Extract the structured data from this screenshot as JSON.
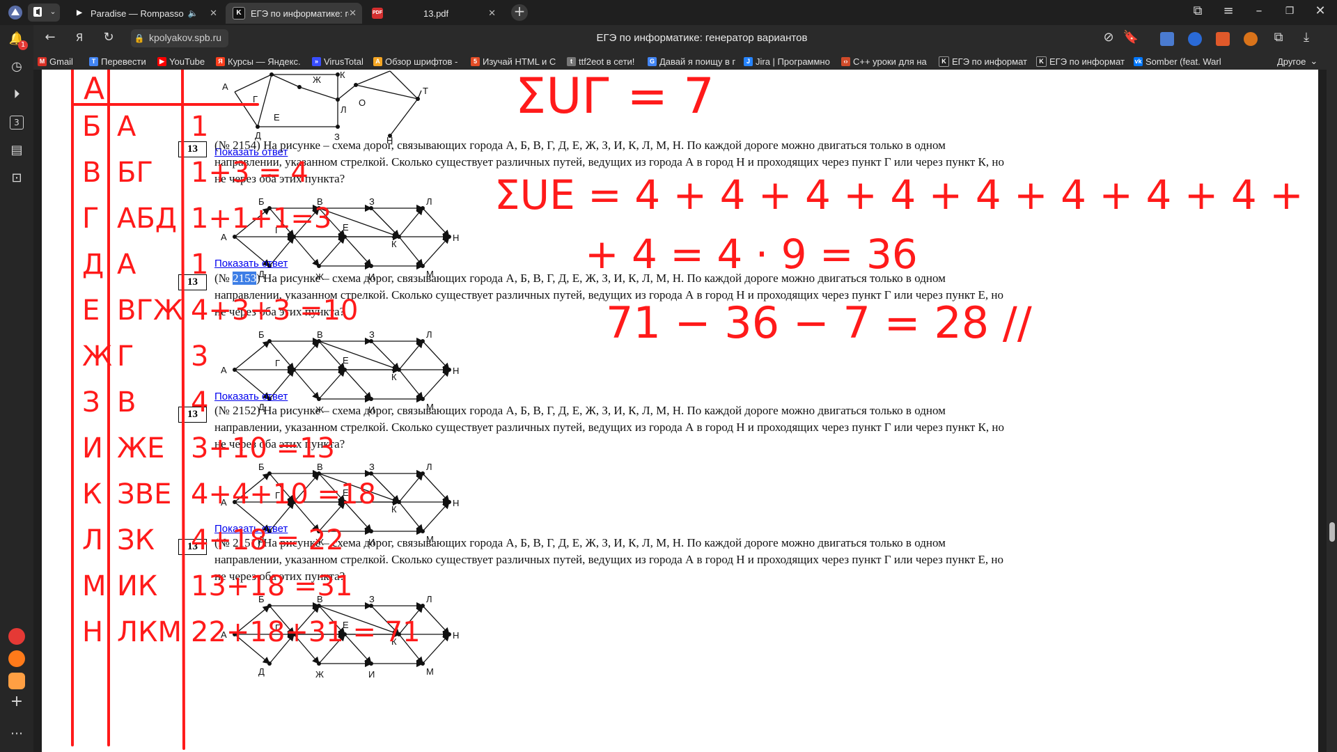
{
  "browser": {
    "tabs": [
      {
        "title": "Paradise — Rompasso",
        "favicon": "play-icon",
        "audio": true,
        "active": false
      },
      {
        "title": "ЕГЭ по информатике: ге",
        "favicon": "K-icon",
        "active": true
      },
      {
        "title": "13.pdf",
        "favicon": "pdf-icon",
        "active": false
      }
    ],
    "address": "kpolyakov.spb.ru",
    "page_title": "ЕГЭ по информатике: генератор вариантов",
    "notification_badge": "1",
    "sidebar_counter": "3",
    "bookmarks": [
      {
        "label": "Gmail",
        "icon": "gmail-icon",
        "color": "#d93025"
      },
      {
        "label": "Перевести",
        "icon": "translate-icon",
        "color": "#4285f4"
      },
      {
        "label": "YouTube",
        "icon": "youtube-icon",
        "color": "#ff0000"
      },
      {
        "label": "Курсы — Яндекс.",
        "icon": "yandex-icon",
        "color": "#fc3f1d"
      },
      {
        "label": "VirusTotal",
        "icon": "virustotal-icon",
        "color": "#394eff"
      },
      {
        "label": "Обзор шрифтов -",
        "icon": "fonts-icon",
        "color": "#f5a623"
      },
      {
        "label": "Изучай HTML и С",
        "icon": "html-icon",
        "color": "#e34c26"
      },
      {
        "label": "ttf2eot в сети!",
        "icon": "ttf-icon",
        "color": "#777777"
      },
      {
        "label": "Давай я поищу в г",
        "icon": "google-icon",
        "color": "#4285f4"
      },
      {
        "label": "Jira | Программно",
        "icon": "jira-icon",
        "color": "#2684ff"
      },
      {
        "label": "C++ уроки для на",
        "icon": "cpp-icon",
        "color": "#d04b2a"
      },
      {
        "label": "ЕГЭ по информат",
        "icon": "K-icon",
        "color": "#222222"
      },
      {
        "label": "ЕГЭ по информат",
        "icon": "K-icon",
        "color": "#222222"
      },
      {
        "label": "Somber (feat. Warl",
        "icon": "vk-icon",
        "color": "#0077ff"
      }
    ],
    "bookmarks_other": "Другое"
  },
  "tasks": [
    {
      "box": "13",
      "id_prefix": "(№ ",
      "id": "2154",
      "id_suffix": ") ",
      "text": "На рисунке – схема дорог, связывающих города А, Б, В, Г, Д, Е, Ж, З, И, К, Л, М, Н. По каждой дороге можно двигаться только в одном направлении, указанном стрелкой. Сколько существует различных путей, ведущих из города А в город Н и проходящих через пункт Г или через пункт К, но не через оба этих пункта?",
      "answer_link": "Показать ответ",
      "selected": false
    },
    {
      "box": "13",
      "id_prefix": "(№ ",
      "id": "2153",
      "id_suffix": ") ",
      "text": "На рисунке – схема дорог, связывающих города А, Б, В, Г, Д, Е, Ж, З, И, К, Л, М, Н. По каждой дороге можно двигаться только в одном направлении, указанном стрелкой. Сколько существует различных путей, ведущих из города А в город Н и проходящих через пункт Г или через пункт Е, но не через оба этих пункта?",
      "answer_link": "Показать ответ",
      "selected": true
    },
    {
      "box": "13",
      "id_prefix": "(№ ",
      "id": "2152",
      "id_suffix": ") ",
      "text": "На рисунке – схема дорог, связывающих города А, Б, В, Г, Д, Е, Ж, З, И, К, Л, М, Н. По каждой дороге можно двигаться только в одном направлении, указанном стрелкой. Сколько существует различных путей, ведущих из города А в город Н и проходящих через пункт Г или через пункт К, но не через оба этих пункта?",
      "answer_link": "Показать ответ",
      "selected": false
    },
    {
      "box": "13",
      "id_prefix": "(№ ",
      "id": "2151",
      "id_suffix": ") ",
      "text": "На рисунке – схема дорог, связывающих города А, Б, В, Г, Д, Е, Ж, З, И, К, Л, М, Н. По каждой дороге можно двигаться только в одном направлении, указанном стрелкой. Сколько существует различных путей, ведущих из города А в город Н и проходящих через пункт Г или через пункт Е, но не через оба этих пункта?",
      "answer_link": "Показать ответ",
      "selected": false
    }
  ],
  "top_partial": {
    "answer_link": "Показать ответ"
  },
  "graph_labels": [
    "А",
    "Б",
    "В",
    "Г",
    "Д",
    "Е",
    "Ж",
    "З",
    "И",
    "К",
    "Л",
    "М",
    "Н"
  ],
  "top_graph_labels": [
    "А",
    "Г",
    "Е",
    "Ж",
    "К",
    "Л",
    "О",
    "Т",
    "Д",
    "З",
    "Н"
  ],
  "handwriting": {
    "color": "#ff1a1a",
    "table_header": "А",
    "table_rows": [
      [
        "Б",
        "А",
        "1"
      ],
      [
        "В",
        "БГ",
        "1+3 = 4"
      ],
      [
        "Г",
        "АБД",
        "1+1+1=3"
      ],
      [
        "Д",
        "А",
        "1"
      ],
      [
        "Е",
        "ВГЖ",
        "4+3+3 =10"
      ],
      [
        "Ж",
        "Г",
        "3"
      ],
      [
        "З",
        "В",
        "4"
      ],
      [
        "И",
        "ЖЕ",
        "3+10 =13"
      ],
      [
        "К",
        "ЗВЕ",
        "4+4+10 =18"
      ],
      [
        "Л",
        "ЗК",
        "4+18 = 22"
      ],
      [
        "М",
        "ИК",
        "13+18 =31"
      ],
      [
        "Н",
        "ЛКМ",
        "22+18+31 = 71"
      ]
    ],
    "notes": [
      "ΣUГ = 7",
      "ΣUE = 4 + 4 + 4 + 4 + 4 + 4 + 4 + 4 +",
      "+ 4 = 4 · 9 = 36",
      "71 − 36 − 7 = 28 //"
    ]
  }
}
